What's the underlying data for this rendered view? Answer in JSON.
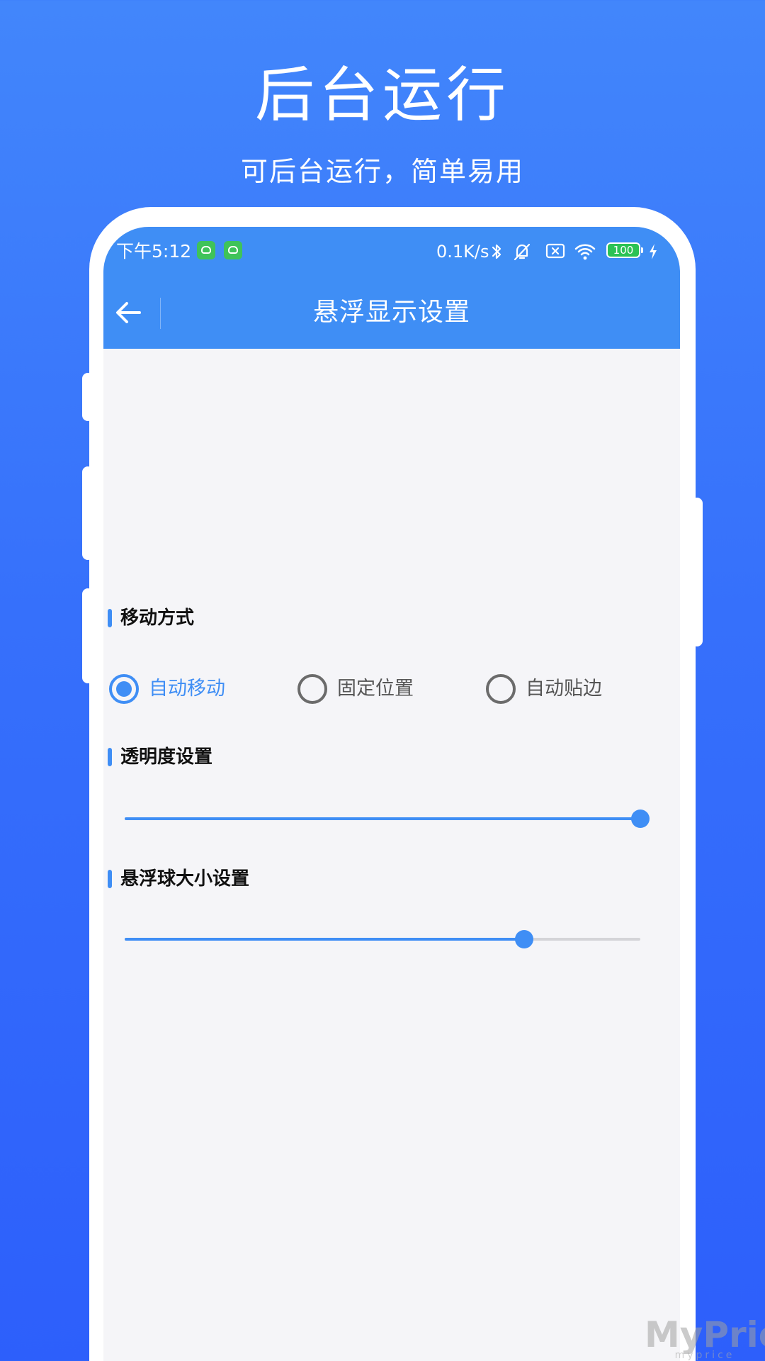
{
  "promo": {
    "title": "后台运行",
    "subtitle": "可后台运行，简单易用"
  },
  "status_bar": {
    "time": "下午5:12",
    "net_speed": "0.1K/s",
    "battery_level": "100"
  },
  "app_bar": {
    "title": "悬浮显示设置"
  },
  "sections": {
    "move_mode": {
      "label": "移动方式",
      "options": [
        {
          "label": "自动移动",
          "checked": true
        },
        {
          "label": "固定位置",
          "checked": false
        },
        {
          "label": "自动贴边",
          "checked": false
        }
      ]
    },
    "opacity": {
      "label": "透明度设置",
      "value": 1.0
    },
    "ball_size": {
      "label": "悬浮球大小设置",
      "value": 0.775
    }
  },
  "colors": {
    "accent": "#3f8ef5",
    "background_gradient_top": "#4286fb",
    "background_gradient_bottom": "#2d5ffb",
    "screen_bg": "#f5f5f8"
  },
  "watermark": {
    "text": "MyPrice",
    "sub": "myprice"
  }
}
